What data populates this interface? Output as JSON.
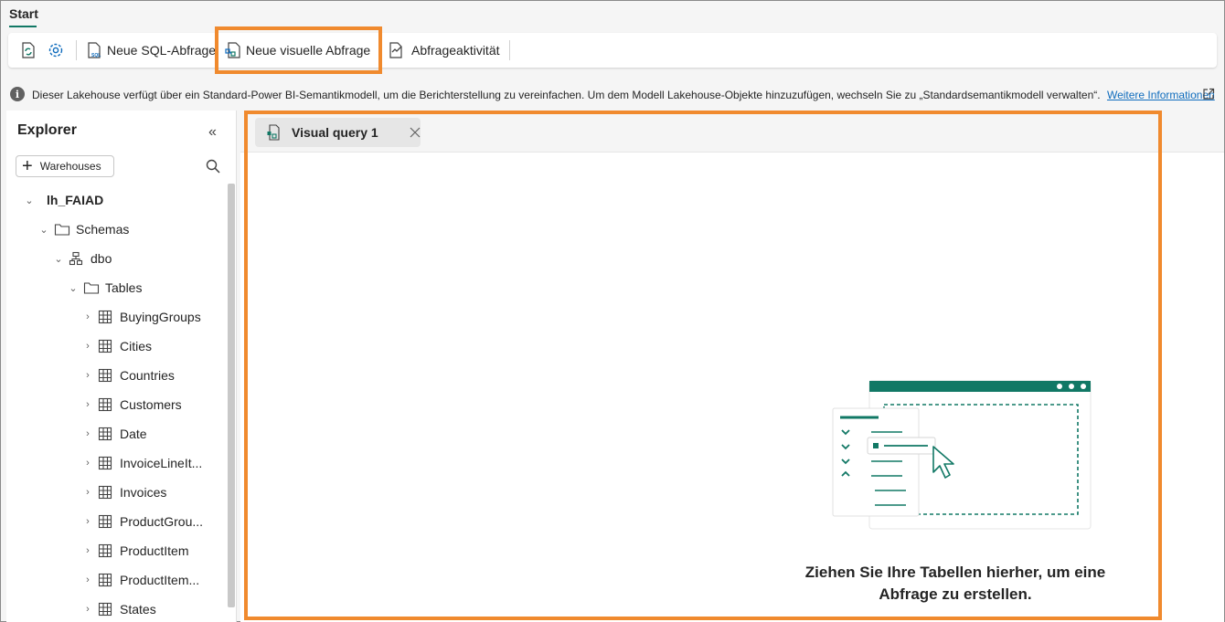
{
  "tabstrip": {
    "start_label": "Start"
  },
  "toolbar": {
    "refresh_icon": "refresh-icon",
    "settings_icon": "gear-icon",
    "new_sql_label": "Neue SQL-Abfrage",
    "new_visual_label": "Neue visuelle Abfrage",
    "query_activity_label": "Abfrageaktivität"
  },
  "infobar": {
    "text": "Dieser Lakehouse verfügt über ein Standard-Power BI-Semantikmodell, um die Berichterstellung zu vereinfachen. Um dem Modell Lakehouse-Objekte hinzuzufügen, wechseln Sie zu „Standardsemantikmodell verwalten“.",
    "link": "Weitere Informationen"
  },
  "explorer": {
    "title": "Explorer",
    "warehouses_button": "Warehouses",
    "tree": {
      "root": "lh_FAIAD",
      "schemas": "Schemas",
      "dbo": "dbo",
      "tables": "Tables",
      "items": [
        "BuyingGroups",
        "Cities",
        "Countries",
        "Customers",
        "Date",
        "InvoiceLineIt...",
        "Invoices",
        "ProductGrou...",
        "ProductItem",
        "ProductItem...",
        "States"
      ]
    }
  },
  "main": {
    "tab_label": "Visual query 1",
    "empty_message": "Ziehen Sie Ihre Tabellen hierher, um eine Abfrage zu erstellen."
  },
  "colors": {
    "accent": "#117865",
    "highlight": "#f08a2e",
    "link": "#0f6cbd"
  }
}
